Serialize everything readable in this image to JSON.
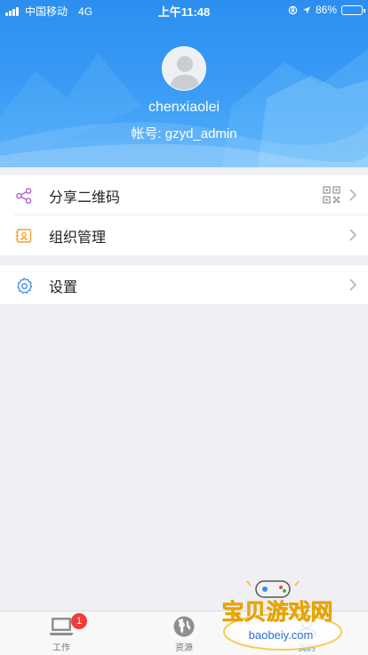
{
  "status_bar": {
    "carrier": "中国移动",
    "network": "4G",
    "time": "上午11:48",
    "battery_percent": "86%",
    "battery_level": 0.86
  },
  "profile": {
    "username": "chenxiaolei",
    "account": "帐号: gzyd_admin"
  },
  "menu": {
    "share_qr": {
      "label": "分享二维码",
      "icon": "share-icon"
    },
    "org_manage": {
      "label": "组织管理",
      "icon": "contact-card-icon"
    },
    "settings": {
      "label": "设置",
      "icon": "gear-icon"
    }
  },
  "tabbar": {
    "tabs": [
      {
        "label": "工作",
        "icon": "laptop-icon",
        "badge": "1"
      },
      {
        "label": "资源",
        "icon": "globe-icon"
      },
      {
        "label": "我的",
        "icon": "person-icon",
        "active": true
      }
    ]
  },
  "watermark": {
    "title": "宝贝游戏网",
    "url": "baobeiy.com"
  },
  "colors": {
    "header_blue": "#2c8ff0",
    "accent": "#2b8bf0",
    "share_icon": "#b25ed9",
    "org_icon": "#f0a030",
    "settings_icon": "#3a8ee6",
    "badge": "#f23b3b"
  }
}
